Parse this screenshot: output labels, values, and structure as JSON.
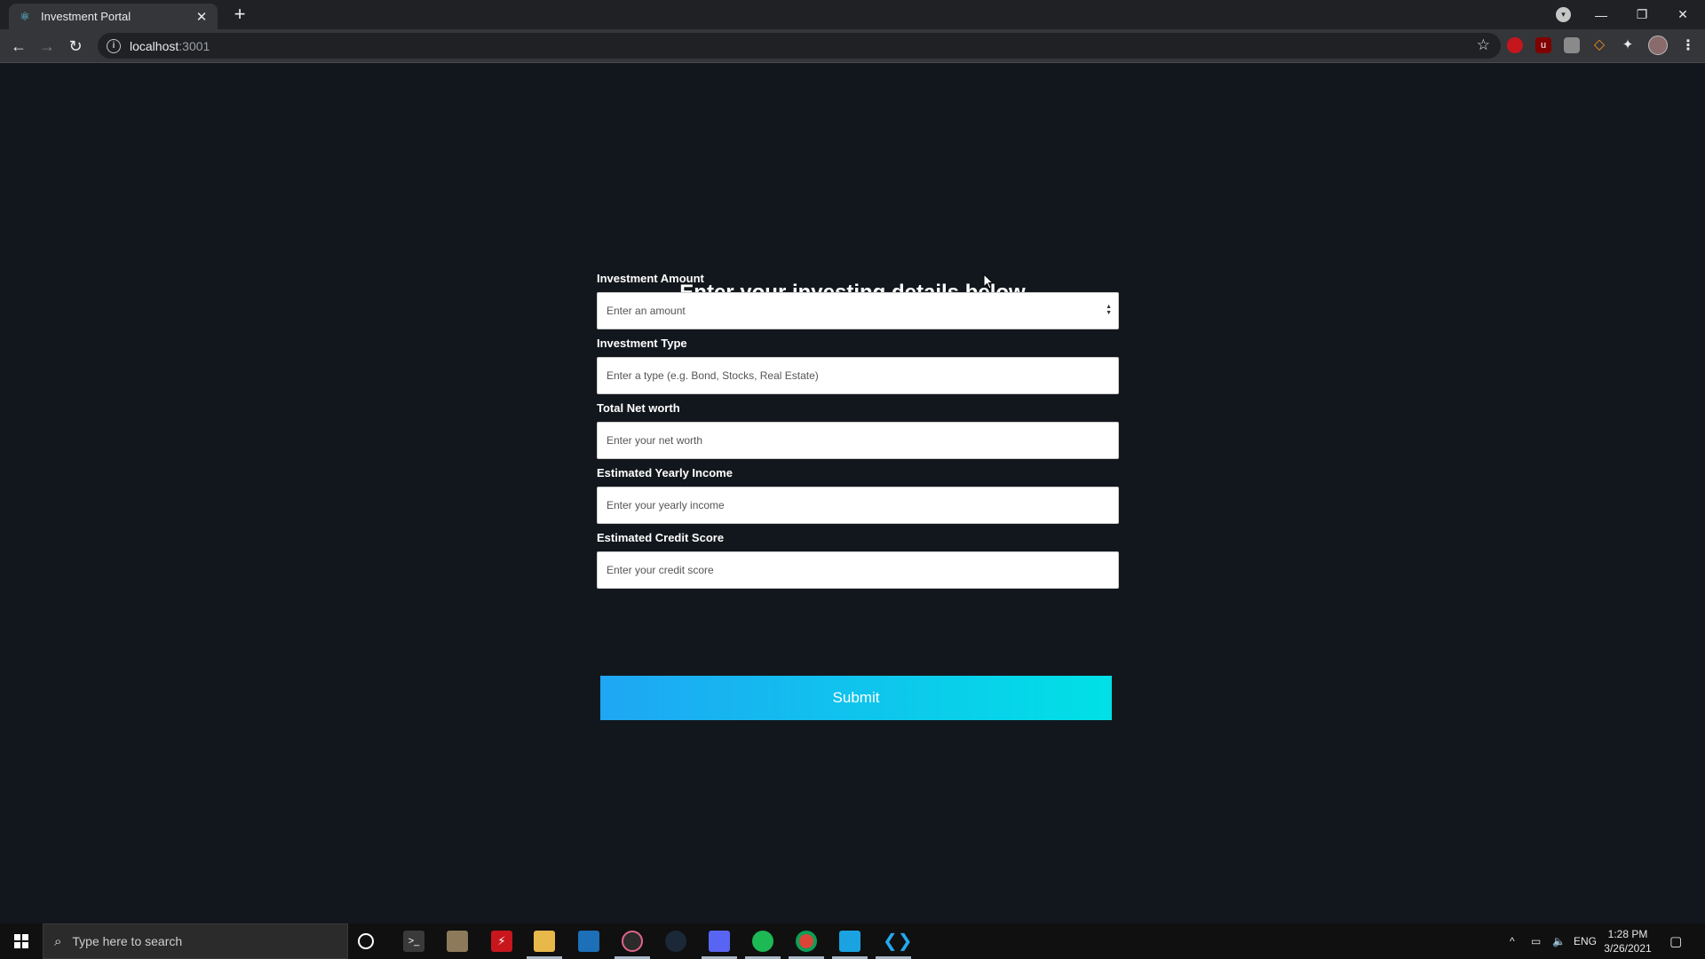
{
  "browser": {
    "tab_title": "Investment Portal",
    "tab_close": "✕",
    "new_tab": "+",
    "url_host": "localhost",
    "url_port": ":3001"
  },
  "page": {
    "heading": "Enter your investing details below",
    "fields": [
      {
        "label": "Investment Amount",
        "placeholder": "Enter an amount"
      },
      {
        "label": "Investment Type",
        "placeholder": "Enter a type (e.g. Bond, Stocks, Real Estate)"
      },
      {
        "label": "Total Net worth",
        "placeholder": "Enter your net worth"
      },
      {
        "label": "Estimated Yearly Income",
        "placeholder": "Enter your yearly income"
      },
      {
        "label": "Estimated Credit Score",
        "placeholder": "Enter your credit score"
      }
    ],
    "submit_label": "Submit"
  },
  "taskbar": {
    "search_placeholder": "Type here to search",
    "language": "ENG",
    "time": "1:28 PM",
    "date": "3/26/2021"
  },
  "colors": {
    "page_background": "#12171d",
    "submit_gradient_start": "#1fa6f4",
    "submit_gradient_end": "#00e1e6"
  }
}
